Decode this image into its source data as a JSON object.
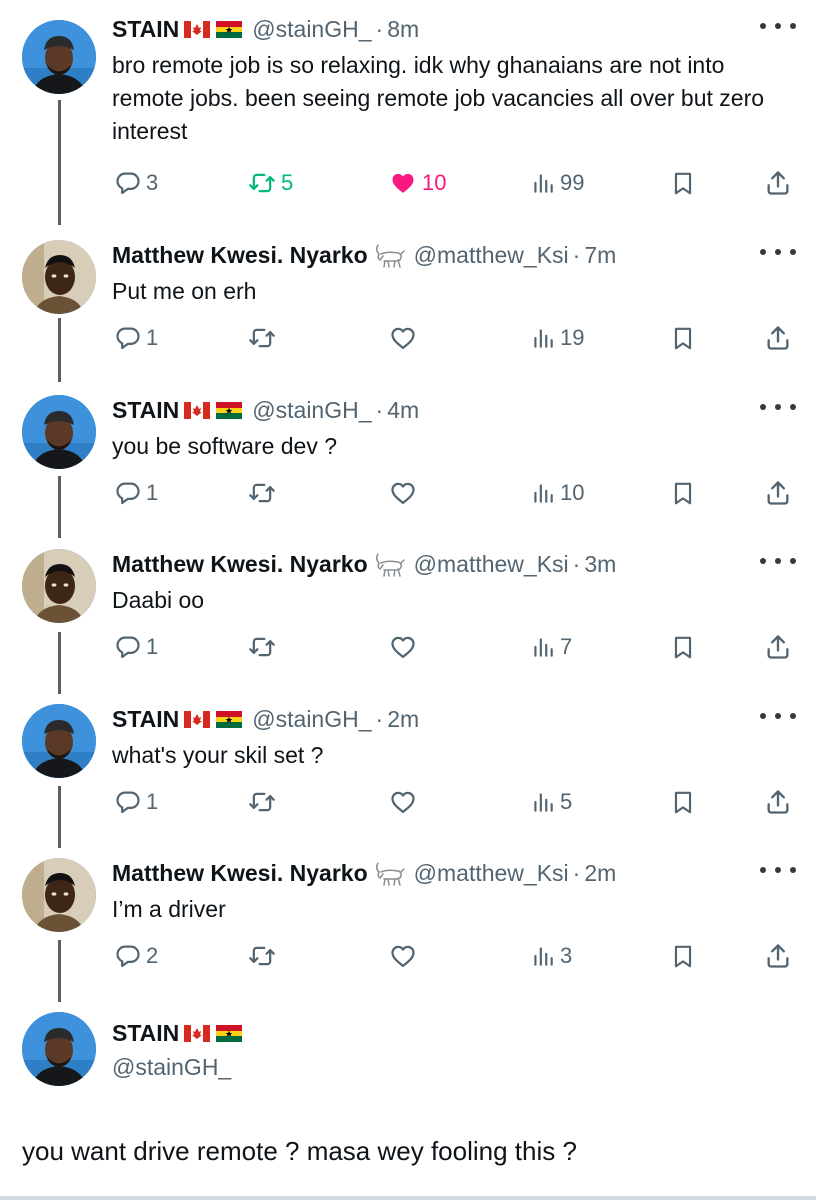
{
  "tweets": [
    {
      "name": "STAIN",
      "handle": "@stainGH_",
      "time": "8m",
      "text": "bro remote job is so relaxing. idk why ghanaians are not into remote jobs. been seeing remote job vacancies all over but zero interest",
      "replies": "3",
      "retweets": "5",
      "likes": "10",
      "views": "99",
      "liked": true,
      "retweeted": true
    },
    {
      "name": "Matthew Kwesi. Nyarko",
      "handle": "@matthew_Ksi",
      "time": "7m",
      "text": "Put me on erh",
      "replies": "1",
      "retweets": "",
      "likes": "",
      "views": "19"
    },
    {
      "name": "STAIN",
      "handle": "@stainGH_",
      "time": "4m",
      "text": "you be software dev ?",
      "replies": "1",
      "retweets": "",
      "likes": "",
      "views": "10"
    },
    {
      "name": "Matthew Kwesi. Nyarko",
      "handle": "@matthew_Ksi",
      "time": "3m",
      "text": "Daabi oo",
      "replies": "1",
      "retweets": "",
      "likes": "",
      "views": "7"
    },
    {
      "name": "STAIN",
      "handle": "@stainGH_",
      "time": "2m",
      "text": "what's your skil set ?",
      "replies": "1",
      "retweets": "",
      "likes": "",
      "views": "5"
    },
    {
      "name": "Matthew Kwesi. Nyarko",
      "handle": "@matthew_Ksi",
      "time": "2m",
      "text": "I’m a driver",
      "replies": "2",
      "retweets": "",
      "likes": "",
      "views": "3"
    }
  ],
  "final_reply": {
    "name": "STAIN",
    "handle": "@stainGH_",
    "text": "you want drive remote ? masa wey fooling this ?"
  },
  "icons": {
    "reply": "reply-icon",
    "retweet": "retweet-icon",
    "like": "heart-icon",
    "views": "views-icon",
    "bookmark": "bookmark-icon",
    "share": "share-icon",
    "more": "more-icon",
    "flag_1": "canada-flag-icon",
    "flag_2": "ghana-flag-icon",
    "badge": "goat-icon"
  },
  "colors": {
    "like_active": "#f91880",
    "retweet_active": "#00ba7c",
    "muted": "#536471",
    "text": "#0f1419"
  }
}
